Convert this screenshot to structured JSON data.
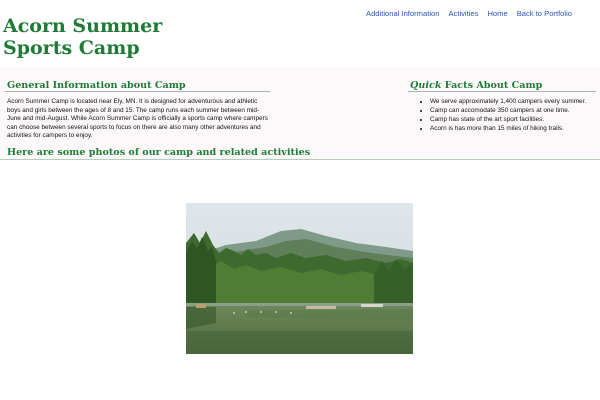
{
  "header": {
    "title": "Acorn Summer Sports Camp"
  },
  "nav": {
    "items": [
      "Additional Information",
      "Activities",
      "Home",
      "Back to Portfolio"
    ]
  },
  "general": {
    "heading": "General Information about Camp",
    "text": "Acorn Summer Camp is located near Ely, MN. It is designed for adventurous and athletic boys and girls between the ages of 8 and 15. The camp runs each summer between mid-June and mid-August. While Acorn Summer Camp is officially a sports camp where campers can choose between several sports to focus on there are also many other adventures and activities for campers to enjoy."
  },
  "quick": {
    "heading_em": "Quick",
    "heading_rest": " Facts About Camp",
    "items": [
      "We serve approximately 1,400 campers every summer.",
      "Camp can accomodate 350 campers at one time.",
      "Camp has state of the art sport facilities.",
      "Acorn is has more than 15 miles of hiking trails."
    ]
  },
  "photos": {
    "heading": "Here are some photos of our camp and related activities"
  }
}
